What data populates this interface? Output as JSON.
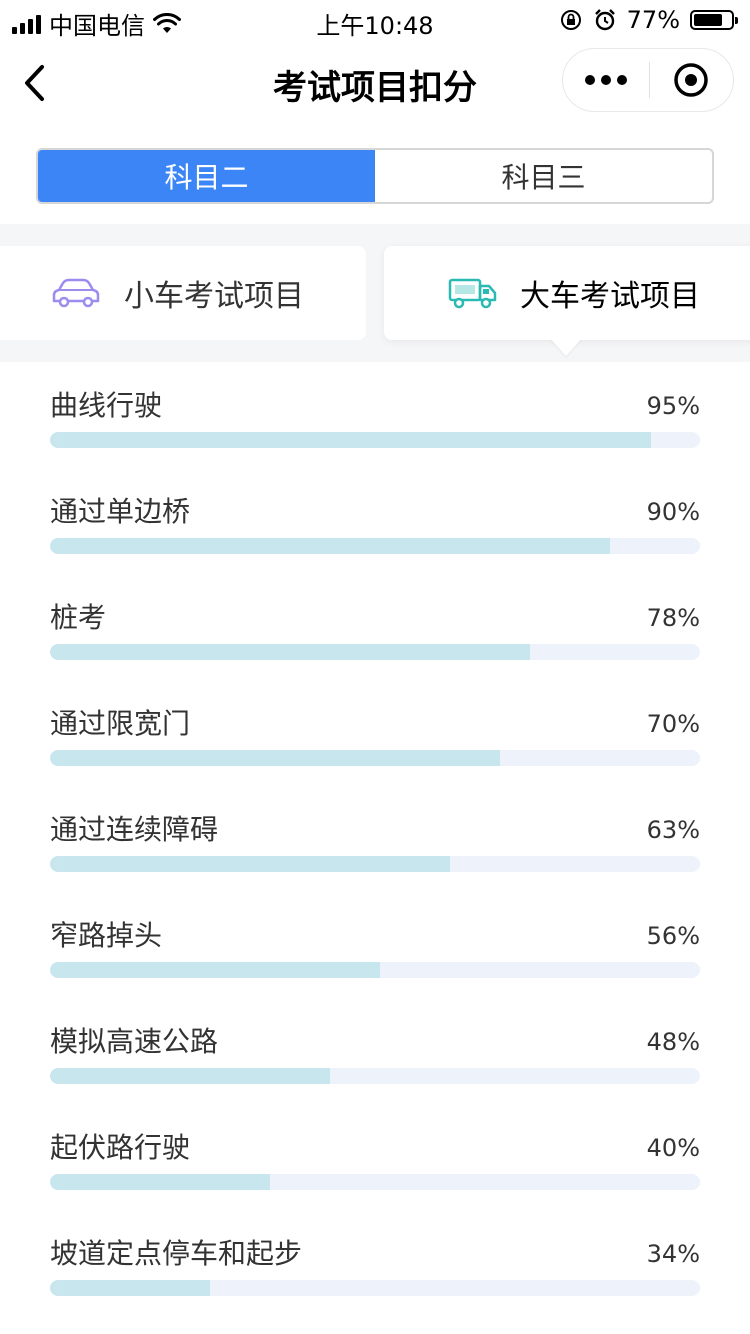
{
  "status_bar": {
    "carrier": "中国电信",
    "time": "上午10:48",
    "battery_text": "77%",
    "battery_level": 0.77
  },
  "nav": {
    "title": "考试项目扣分"
  },
  "subject_tabs": [
    {
      "label": "科目二",
      "active": true
    },
    {
      "label": "科目三",
      "active": false
    }
  ],
  "vehicle_tabs": [
    {
      "label": "小车考试项目",
      "icon": "car-icon",
      "selected": false
    },
    {
      "label": "大车考试项目",
      "icon": "truck-icon",
      "selected": true
    }
  ],
  "items": [
    {
      "label": "曲线行驶",
      "percent_text": "95%",
      "fill": 0.925
    },
    {
      "label": "通过单边桥",
      "percent_text": "90%",
      "fill": 0.862
    },
    {
      "label": "桩考",
      "percent_text": "78%",
      "fill": 0.738
    },
    {
      "label": "通过限宽门",
      "percent_text": "70%",
      "fill": 0.692
    },
    {
      "label": "通过连续障碍",
      "percent_text": "63%",
      "fill": 0.615
    },
    {
      "label": "窄路掉头",
      "percent_text": "56%",
      "fill": 0.508
    },
    {
      "label": "模拟高速公路",
      "percent_text": "48%",
      "fill": 0.431
    },
    {
      "label": "起伏路行驶",
      "percent_text": "40%",
      "fill": 0.338
    },
    {
      "label": "坡道定点停车和起步",
      "percent_text": "34%",
      "fill": 0.246
    }
  ]
}
